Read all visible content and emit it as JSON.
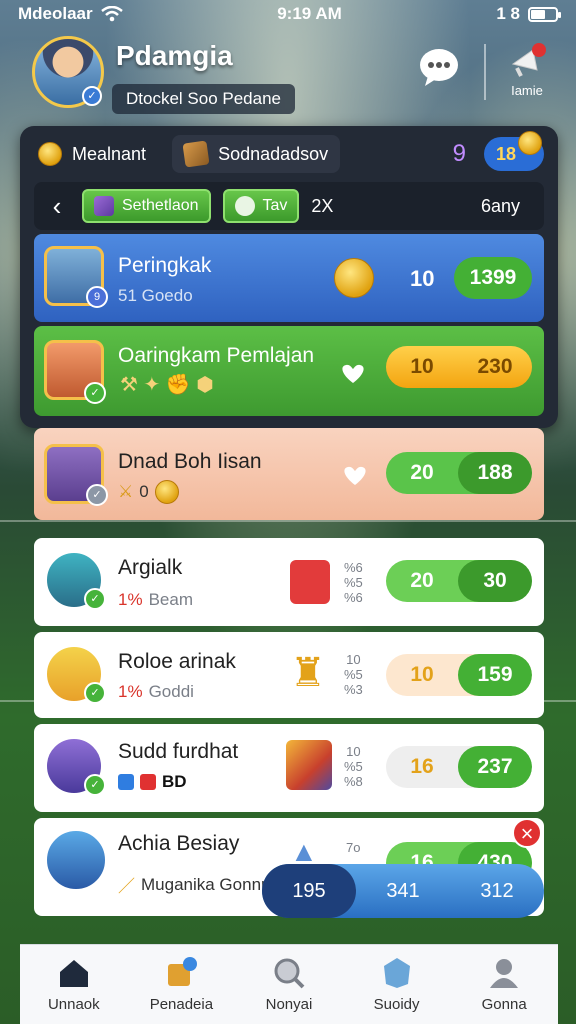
{
  "status_bar": {
    "carrier": "Mdeolaar",
    "time": "9:19 AM",
    "signal": "1 8"
  },
  "profile": {
    "name": "Pdamgia",
    "subtitle": "Dtockel Soo Pedane",
    "tool_label": "Iamie"
  },
  "currency": {
    "coin_label": "Mealnant",
    "crate_label": "Sodnadadsov",
    "level": "9",
    "blue_value": "18"
  },
  "tabs": {
    "tab1": "Sethetlaon",
    "tab2": "Tav",
    "mult": "2X",
    "right": "6any"
  },
  "rows": [
    {
      "name": "Peringkak",
      "sub": "51 Goedo",
      "num": "10",
      "score": "1399"
    },
    {
      "name": "Oaringkam Pemlajan",
      "num": "10",
      "score": "230"
    },
    {
      "name": "Dnad Boh Iisan",
      "sub": "0",
      "num": "20",
      "score": "188"
    },
    {
      "name": "Argialk",
      "sub_pct": "1%",
      "sub": "Beam",
      "stats": [
        "%6",
        "%5",
        "%6"
      ],
      "num": "20",
      "score": "30"
    },
    {
      "name": "Roloe arinak",
      "sub_pct": "1%",
      "sub": "Goddi",
      "stats": [
        "10",
        "%5",
        "%3"
      ],
      "num": "10",
      "score": "159"
    },
    {
      "name": "Sudd furdhat",
      "sub": "BD",
      "stats": [
        "10",
        "%5",
        "%8"
      ],
      "num": "16",
      "score": "237"
    },
    {
      "name": "Achia Besiay",
      "sub": "Muganika Gonnr",
      "stats": [
        "7o"
      ],
      "num": "16",
      "score": "430"
    }
  ],
  "float_bar": {
    "a": "195",
    "b": "341",
    "c": "312"
  },
  "nav": [
    "Unnaok",
    "Penadeia",
    "Nonyai",
    "Suoidy",
    "Gonna"
  ],
  "colors": {
    "blue_row": "#3b74cf",
    "green_row": "#49a93a",
    "peach_row": "#f6c8b0",
    "green_score": "#44b035",
    "yellow_score": "#f6b817"
  }
}
